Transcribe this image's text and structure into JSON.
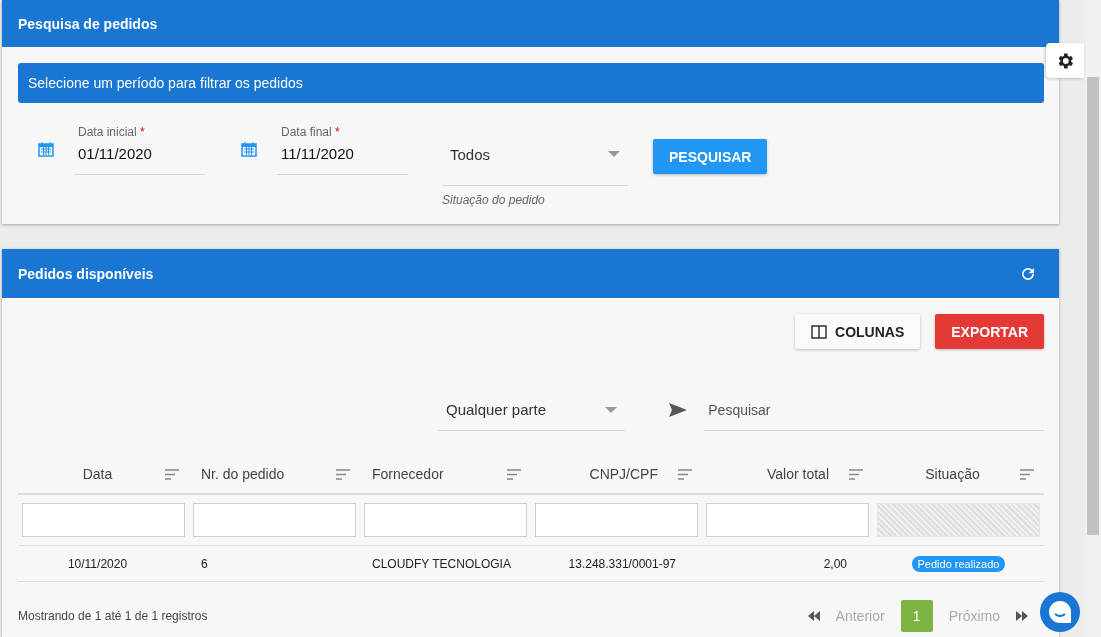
{
  "search_panel": {
    "title": "Pesquisa de pedidos",
    "notice": "Selecione um período para filtrar os pedidos",
    "date_fields": [
      {
        "label": "Data inicial",
        "required_mark": "*",
        "value": "01/11/2020"
      },
      {
        "label": "Data final",
        "required_mark": "*",
        "value": "11/11/2020"
      }
    ],
    "status_select": {
      "value": "Todos",
      "hint": "Situação do pedido"
    },
    "search_button": "PESQUISAR"
  },
  "orders_panel": {
    "title": "Pedidos disponíveis",
    "columns_button": "COLUNAS",
    "export_button": "EXPORTAR",
    "match_select": "Qualquer parte",
    "search": {
      "placeholder": "Pesquisar"
    },
    "table": {
      "columns": [
        {
          "label": "Data",
          "filterable": true
        },
        {
          "label": "Nr. do pedido",
          "filterable": true
        },
        {
          "label": "Fornecedor",
          "filterable": true
        },
        {
          "label": "CNPJ/CPF",
          "filterable": true
        },
        {
          "label": "Valor total",
          "filterable": true
        },
        {
          "label": "Situação",
          "filterable": false
        }
      ],
      "rows": [
        {
          "cells": [
            "10/11/2020",
            "6",
            "CLOUDFY TECNOLOGIA",
            "13.248.331/0001-97",
            "2,00"
          ],
          "status": "Pedido realizado"
        }
      ]
    },
    "footer": "Mostrando de 1 até 1 de 1 registros",
    "pagination": {
      "previous": {
        "label": "Anterior",
        "disabled": true
      },
      "pages": [
        {
          "label": "1",
          "selected": true
        }
      ],
      "next": {
        "label": "Próximo",
        "disabled": true
      }
    }
  }
}
